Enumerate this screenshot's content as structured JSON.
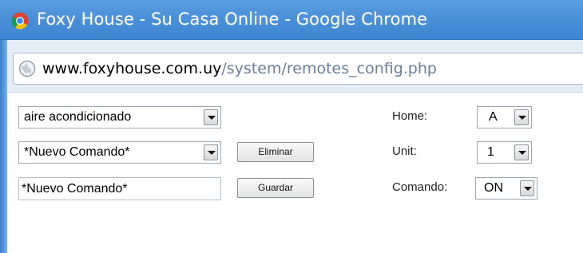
{
  "window": {
    "title": "Foxy House - Su Casa Online - Google Chrome"
  },
  "omnibox": {
    "url_host": "www.foxyhouse.com.uy",
    "url_path": "/system/remotes_config.php"
  },
  "form": {
    "device_select": {
      "value": "aire acondicionado"
    },
    "command_select": {
      "value": "*Nuevo Comando*"
    },
    "delete_button": {
      "label": "Eliminar"
    },
    "command_name_input": {
      "value": "*Nuevo Comando*"
    },
    "save_button": {
      "label": "Guardar"
    },
    "home": {
      "label": "Home:",
      "value": "A"
    },
    "unit": {
      "label": "Unit:",
      "value": "1"
    },
    "comando": {
      "label": "Comando:",
      "value": "ON"
    }
  },
  "icons": {
    "app": "chrome-logo-icon",
    "site": "globe-icon",
    "dropdown": "chevron-down-icon"
  },
  "colors": {
    "titlebar": "#4a8fd8",
    "toolbar": "#e4ecf6",
    "url_path": "#6b7f9a"
  }
}
